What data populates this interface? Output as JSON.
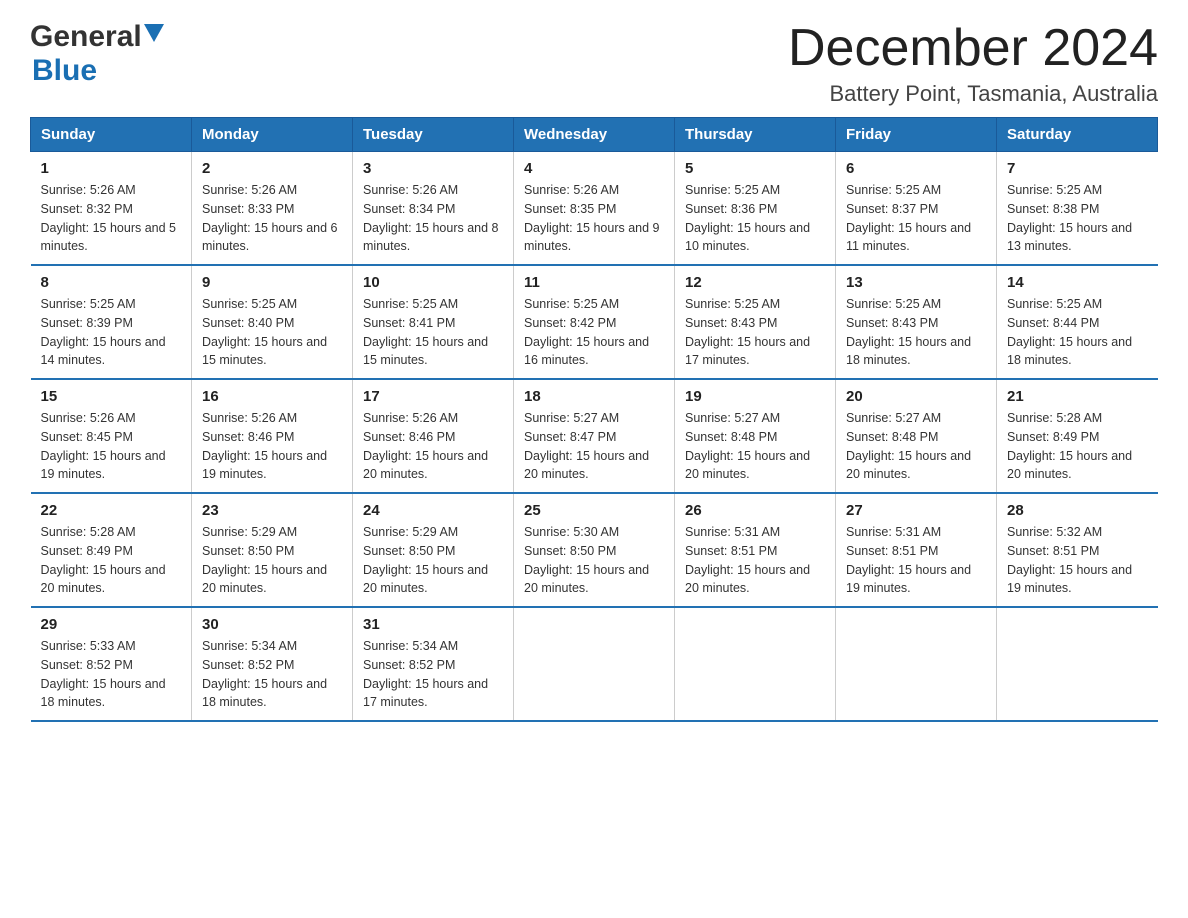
{
  "header": {
    "logo_general": "General",
    "logo_blue": "Blue",
    "month_title": "December 2024",
    "subtitle": "Battery Point, Tasmania, Australia"
  },
  "weekdays": [
    "Sunday",
    "Monday",
    "Tuesday",
    "Wednesday",
    "Thursday",
    "Friday",
    "Saturday"
  ],
  "weeks": [
    [
      {
        "day": "1",
        "sunrise": "5:26 AM",
        "sunset": "8:32 PM",
        "daylight": "15 hours and 5 minutes."
      },
      {
        "day": "2",
        "sunrise": "5:26 AM",
        "sunset": "8:33 PM",
        "daylight": "15 hours and 6 minutes."
      },
      {
        "day": "3",
        "sunrise": "5:26 AM",
        "sunset": "8:34 PM",
        "daylight": "15 hours and 8 minutes."
      },
      {
        "day": "4",
        "sunrise": "5:26 AM",
        "sunset": "8:35 PM",
        "daylight": "15 hours and 9 minutes."
      },
      {
        "day": "5",
        "sunrise": "5:25 AM",
        "sunset": "8:36 PM",
        "daylight": "15 hours and 10 minutes."
      },
      {
        "day": "6",
        "sunrise": "5:25 AM",
        "sunset": "8:37 PM",
        "daylight": "15 hours and 11 minutes."
      },
      {
        "day": "7",
        "sunrise": "5:25 AM",
        "sunset": "8:38 PM",
        "daylight": "15 hours and 13 minutes."
      }
    ],
    [
      {
        "day": "8",
        "sunrise": "5:25 AM",
        "sunset": "8:39 PM",
        "daylight": "15 hours and 14 minutes."
      },
      {
        "day": "9",
        "sunrise": "5:25 AM",
        "sunset": "8:40 PM",
        "daylight": "15 hours and 15 minutes."
      },
      {
        "day": "10",
        "sunrise": "5:25 AM",
        "sunset": "8:41 PM",
        "daylight": "15 hours and 15 minutes."
      },
      {
        "day": "11",
        "sunrise": "5:25 AM",
        "sunset": "8:42 PM",
        "daylight": "15 hours and 16 minutes."
      },
      {
        "day": "12",
        "sunrise": "5:25 AM",
        "sunset": "8:43 PM",
        "daylight": "15 hours and 17 minutes."
      },
      {
        "day": "13",
        "sunrise": "5:25 AM",
        "sunset": "8:43 PM",
        "daylight": "15 hours and 18 minutes."
      },
      {
        "day": "14",
        "sunrise": "5:25 AM",
        "sunset": "8:44 PM",
        "daylight": "15 hours and 18 minutes."
      }
    ],
    [
      {
        "day": "15",
        "sunrise": "5:26 AM",
        "sunset": "8:45 PM",
        "daylight": "15 hours and 19 minutes."
      },
      {
        "day": "16",
        "sunrise": "5:26 AM",
        "sunset": "8:46 PM",
        "daylight": "15 hours and 19 minutes."
      },
      {
        "day": "17",
        "sunrise": "5:26 AM",
        "sunset": "8:46 PM",
        "daylight": "15 hours and 20 minutes."
      },
      {
        "day": "18",
        "sunrise": "5:27 AM",
        "sunset": "8:47 PM",
        "daylight": "15 hours and 20 minutes."
      },
      {
        "day": "19",
        "sunrise": "5:27 AM",
        "sunset": "8:48 PM",
        "daylight": "15 hours and 20 minutes."
      },
      {
        "day": "20",
        "sunrise": "5:27 AM",
        "sunset": "8:48 PM",
        "daylight": "15 hours and 20 minutes."
      },
      {
        "day": "21",
        "sunrise": "5:28 AM",
        "sunset": "8:49 PM",
        "daylight": "15 hours and 20 minutes."
      }
    ],
    [
      {
        "day": "22",
        "sunrise": "5:28 AM",
        "sunset": "8:49 PM",
        "daylight": "15 hours and 20 minutes."
      },
      {
        "day": "23",
        "sunrise": "5:29 AM",
        "sunset": "8:50 PM",
        "daylight": "15 hours and 20 minutes."
      },
      {
        "day": "24",
        "sunrise": "5:29 AM",
        "sunset": "8:50 PM",
        "daylight": "15 hours and 20 minutes."
      },
      {
        "day": "25",
        "sunrise": "5:30 AM",
        "sunset": "8:50 PM",
        "daylight": "15 hours and 20 minutes."
      },
      {
        "day": "26",
        "sunrise": "5:31 AM",
        "sunset": "8:51 PM",
        "daylight": "15 hours and 20 minutes."
      },
      {
        "day": "27",
        "sunrise": "5:31 AM",
        "sunset": "8:51 PM",
        "daylight": "15 hours and 19 minutes."
      },
      {
        "day": "28",
        "sunrise": "5:32 AM",
        "sunset": "8:51 PM",
        "daylight": "15 hours and 19 minutes."
      }
    ],
    [
      {
        "day": "29",
        "sunrise": "5:33 AM",
        "sunset": "8:52 PM",
        "daylight": "15 hours and 18 minutes."
      },
      {
        "day": "30",
        "sunrise": "5:34 AM",
        "sunset": "8:52 PM",
        "daylight": "15 hours and 18 minutes."
      },
      {
        "day": "31",
        "sunrise": "5:34 AM",
        "sunset": "8:52 PM",
        "daylight": "15 hours and 17 minutes."
      },
      null,
      null,
      null,
      null
    ]
  ]
}
